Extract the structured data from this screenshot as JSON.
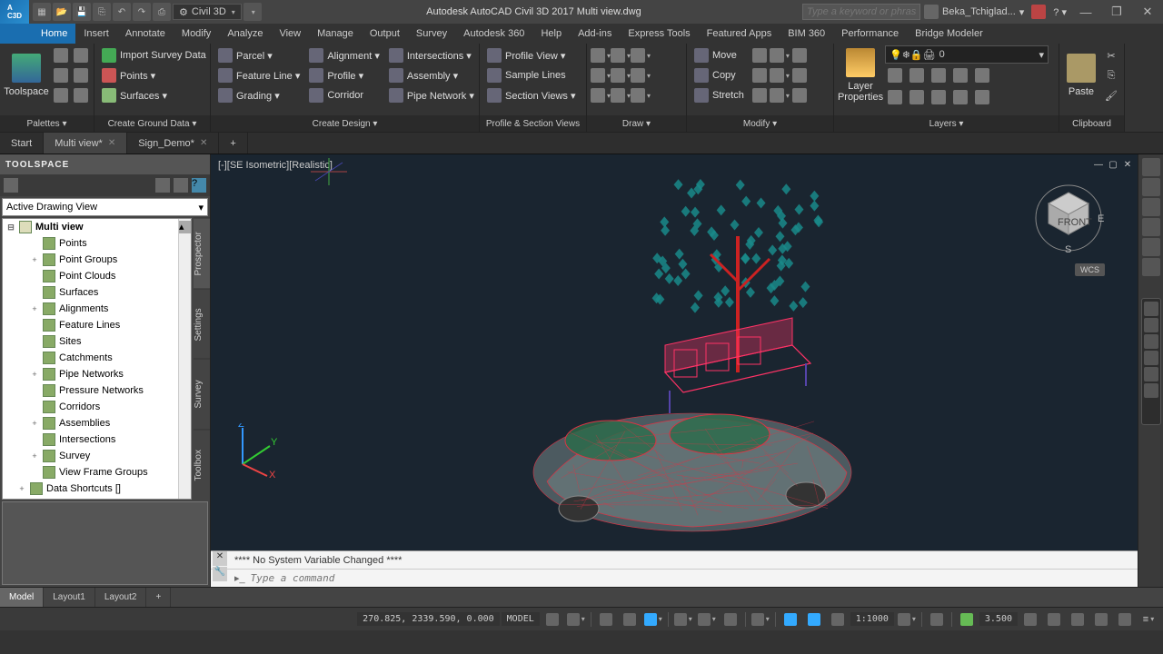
{
  "titlebar": {
    "workspace": "Civil 3D",
    "app_title": "Autodesk AutoCAD Civil 3D 2017   Multi view.dwg",
    "search_placeholder": "Type a keyword or phrase",
    "user": "Beka_Tchiglad...",
    "min": "—",
    "max": "❐",
    "close": "✕"
  },
  "menubar": {
    "tabs": [
      "Home",
      "Insert",
      "Annotate",
      "Modify",
      "Analyze",
      "View",
      "Manage",
      "Output",
      "Survey",
      "Autodesk 360",
      "Help",
      "Add-ins",
      "Express Tools",
      "Featured Apps",
      "BIM 360",
      "Performance",
      "Bridge Modeler"
    ],
    "active": 0
  },
  "ribbon": {
    "palettes": {
      "title": "Palettes ▾",
      "toolspace": "Toolspace"
    },
    "ground": {
      "title": "Create Ground Data ▾",
      "import": "Import Survey Data",
      "points": "Points ▾",
      "surfaces": "Surfaces ▾"
    },
    "design": {
      "title": "Create Design ▾",
      "parcel": "Parcel ▾",
      "featureline": "Feature Line ▾",
      "grading": "Grading ▾",
      "alignment": "Alignment ▾",
      "profile": "Profile ▾",
      "corridor": "Corridor",
      "intersections": "Intersections ▾",
      "assembly": "Assembly ▾",
      "pipenet": "Pipe Network ▾"
    },
    "profile": {
      "title": "Profile & Section Views",
      "pview": "Profile View ▾",
      "sample": "Sample Lines",
      "section": "Section Views ▾"
    },
    "draw": {
      "title": "Draw ▾"
    },
    "modify": {
      "title": "Modify ▾",
      "move": "Move",
      "copy": "Copy",
      "stretch": "Stretch"
    },
    "layers": {
      "title": "Layers ▾",
      "props": "Layer\nProperties",
      "current": "0"
    },
    "clipboard": {
      "title": "Clipboard",
      "paste": "Paste"
    }
  },
  "filetabs": {
    "tabs": [
      "Start",
      "Multi view*",
      "Sign_Demo*"
    ],
    "active": 1
  },
  "toolspace": {
    "title": "TOOLSPACE",
    "combo": "Active Drawing View",
    "vtabs": [
      "Prospector",
      "Settings",
      "Survey",
      "Toolbox"
    ],
    "vtab_active": 0,
    "root": "Multi view",
    "nodes": [
      {
        "l": "Points",
        "i": 1
      },
      {
        "l": "Point Groups",
        "i": 1,
        "exp": "+"
      },
      {
        "l": "Point Clouds",
        "i": 1
      },
      {
        "l": "Surfaces",
        "i": 1
      },
      {
        "l": "Alignments",
        "i": 1,
        "exp": "+"
      },
      {
        "l": "Feature Lines",
        "i": 1
      },
      {
        "l": "Sites",
        "i": 1
      },
      {
        "l": "Catchments",
        "i": 1
      },
      {
        "l": "Pipe Networks",
        "i": 1,
        "exp": "+"
      },
      {
        "l": "Pressure Networks",
        "i": 1
      },
      {
        "l": "Corridors",
        "i": 1
      },
      {
        "l": "Assemblies",
        "i": 1,
        "exp": "+"
      },
      {
        "l": "Intersections",
        "i": 1
      },
      {
        "l": "Survey",
        "i": 1,
        "exp": "+"
      },
      {
        "l": "View Frame Groups",
        "i": 1
      },
      {
        "l": "Data Shortcuts []",
        "i": 0,
        "exp": "+"
      }
    ]
  },
  "viewport": {
    "label": "[-][SE Isometric][Realistic]",
    "wcs": "WCS"
  },
  "cmdline": {
    "history": "**** No System Variable Changed ****",
    "prompt_placeholder": "Type a command"
  },
  "layouts": {
    "tabs": [
      "Model",
      "Layout1",
      "Layout2"
    ],
    "active": 0
  },
  "status": {
    "coords": "270.825, 2339.590, 0.000",
    "model": "MODEL",
    "scale": "1:1000",
    "decimal": "3.500"
  }
}
